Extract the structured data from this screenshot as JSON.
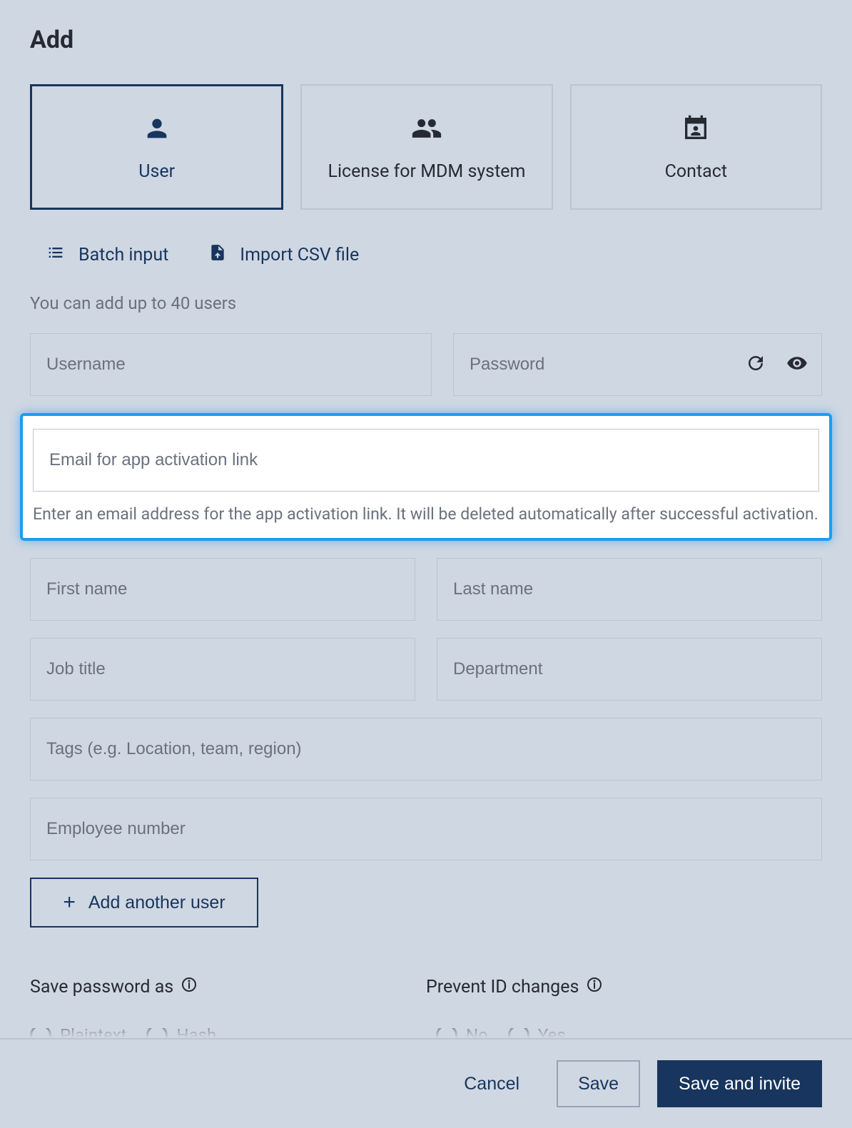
{
  "title": "Add",
  "tabs": {
    "user": "User",
    "license": "License for MDM system",
    "contact": "Contact"
  },
  "actions": {
    "batch_input": "Batch input",
    "import_csv": "Import CSV file"
  },
  "hint": "You can add up to 40 users",
  "fields": {
    "username": "Username",
    "password": "Password",
    "email": "Email for app activation link",
    "email_desc": "Enter an email address for the app activation link. It will be deleted automatically after successful activation.",
    "first_name": "First name",
    "last_name": "Last name",
    "job_title": "Job title",
    "department": "Department",
    "tags": "Tags (e.g. Location, team, region)",
    "employee_number": "Employee number"
  },
  "add_another": "Add another user",
  "settings": {
    "save_password": "Save password as",
    "prevent_id": "Prevent ID changes"
  },
  "radios": {
    "plaintext": "Plaintext",
    "hash": "Hash",
    "no": "No",
    "yes": "Yes"
  },
  "footer": {
    "cancel": "Cancel",
    "save": "Save",
    "save_invite": "Save and invite"
  }
}
